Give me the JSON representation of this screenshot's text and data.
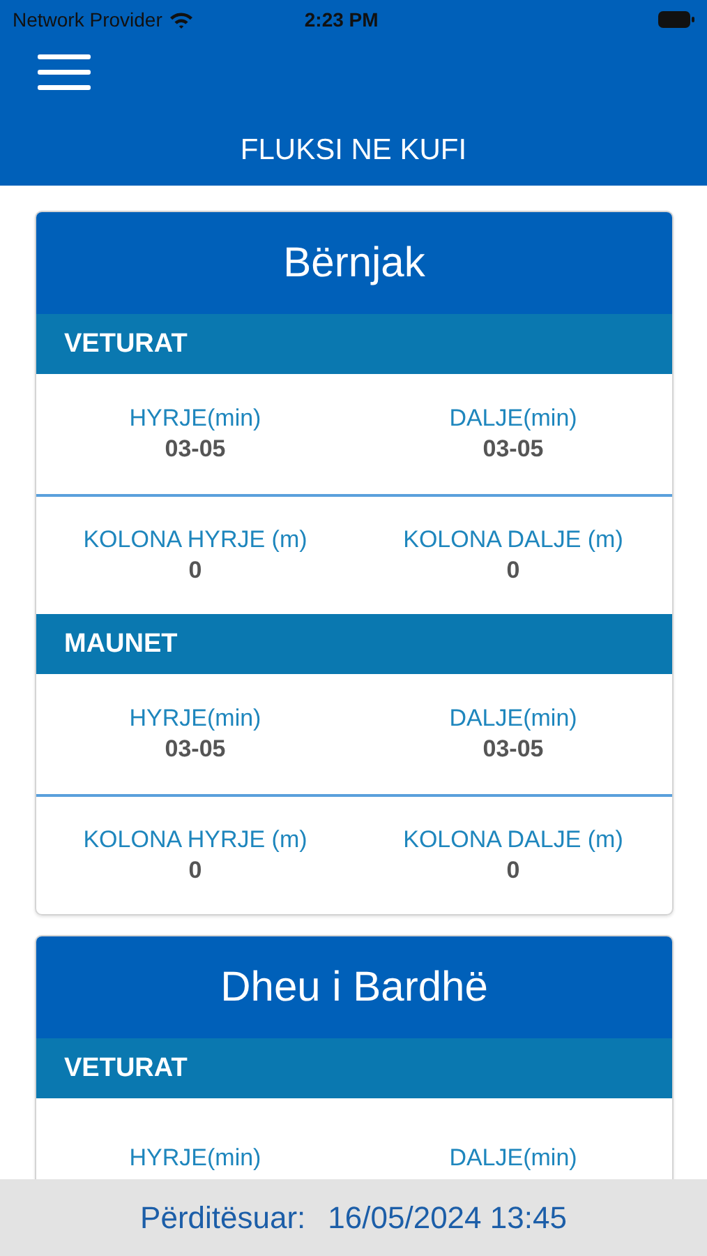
{
  "status_bar": {
    "carrier": "Network Provider",
    "time": "2:23 PM"
  },
  "header": {
    "title": "FLUKSI NE KUFI"
  },
  "cards": [
    {
      "name": "Bërnjak",
      "sections": [
        {
          "title": "VETURAT",
          "rows": [
            [
              {
                "label": "HYRJE(min)",
                "value": "03-05"
              },
              {
                "label": "DALJE(min)",
                "value": "03-05"
              }
            ],
            [
              {
                "label": "KOLONA HYRJE (m)",
                "value": "0"
              },
              {
                "label": "KOLONA DALJE (m)",
                "value": "0"
              }
            ]
          ]
        },
        {
          "title": "MAUNET",
          "rows": [
            [
              {
                "label": "HYRJE(min)",
                "value": "03-05"
              },
              {
                "label": "DALJE(min)",
                "value": "03-05"
              }
            ],
            [
              {
                "label": "KOLONA HYRJE (m)",
                "value": "0"
              },
              {
                "label": "KOLONA DALJE (m)",
                "value": "0"
              }
            ]
          ]
        }
      ]
    },
    {
      "name": "Dheu i Bardhë",
      "sections": [
        {
          "title": "VETURAT",
          "rows": [
            [
              {
                "label": "HYRJE(min)"
              },
              {
                "label": "DALJE(min)"
              }
            ]
          ]
        }
      ]
    }
  ],
  "footer": {
    "label": "Përditësuar:",
    "value": "16/05/2024 13:45"
  }
}
